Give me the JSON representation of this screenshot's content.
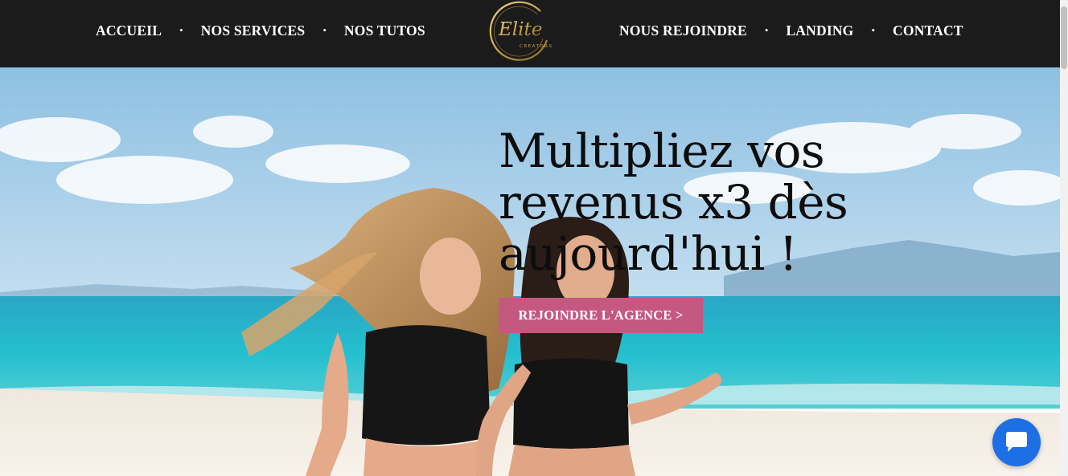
{
  "nav": {
    "left": [
      "ACCUEIL",
      "NOS SERVICES",
      "NOS TUTOS"
    ],
    "right": [
      "NOUS REJOINDRE",
      "LANDING",
      "CONTACT"
    ],
    "separator": "•",
    "logo": {
      "script": "Elite",
      "caption": "CREATORS"
    }
  },
  "hero": {
    "title": "Multipliez vos revenus x3 dès aujourd'hui !",
    "cta": "REJOINDRE L'AGENCE >"
  },
  "chat": {
    "icon": "chat-bubble-icon"
  },
  "colors": {
    "nav_bg": "#1b1b1b",
    "cta_bg": "#c4587f",
    "chat_bg": "#1d6fe6",
    "logo_gold": "#c9a24a",
    "sea": "#28b4c8",
    "sky": "#9fcbe6"
  }
}
